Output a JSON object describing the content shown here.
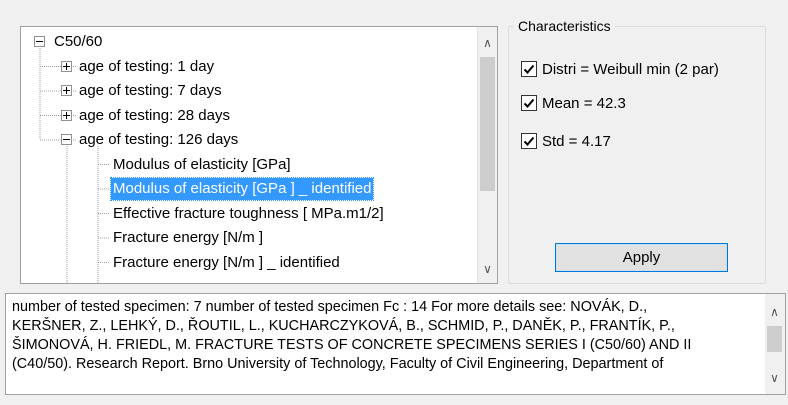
{
  "tree": {
    "root_label": "C50/60",
    "items": [
      {
        "label": "age of testing: 1 day",
        "expander": "plus"
      },
      {
        "label": "age of testing: 7 days",
        "expander": "plus"
      },
      {
        "label": "age of testing: 28 days",
        "expander": "plus"
      },
      {
        "label": "age of testing: 126 days",
        "expander": "minus"
      }
    ],
    "children": [
      {
        "label": "Modulus of elasticity  [GPa]",
        "selected": false
      },
      {
        "label": "Modulus of elasticity  [GPa ] _ identified",
        "selected": true
      },
      {
        "label": "Effective fracture toughness [ MPa.m1/2]",
        "selected": false
      },
      {
        "label": "Fracture energy [N/m ]",
        "selected": false
      },
      {
        "label": "Fracture energy [N/m ] _ identified",
        "selected": false
      }
    ],
    "selection_color": "#3399ff"
  },
  "characteristics": {
    "title": "Characteristics",
    "options": [
      {
        "label": "Distri = Weibull min (2 par)",
        "checked": true
      },
      {
        "label": "Mean = 42.3",
        "checked": true
      },
      {
        "label": "Std = 4.17",
        "checked": true
      }
    ],
    "apply_label": "Apply"
  },
  "details": {
    "lines": [
      "number of tested specimen: 7     number of tested specimen Fc : 14 For more details see: NOVÁK, D.,",
      "KERŠNER, Z., LEHKÝ, D., ŘOUTIL, L., KUCHARCZYKOVÁ, B., SCHMID, P., DANĚK, P., FRANTÍK, P.,",
      "ŠIMONOVÁ, H. FRIEDL, M. FRACTURE TESTS OF CONCRETE SPECIMENS SERIES I (C50/60) AND II",
      "(C40/50). Research Report. Brno University of Technology, Faculty of Civil Engineering, Department of"
    ]
  },
  "icons": {
    "scroll_up": "▲",
    "scroll_down": "▼",
    "tree_scroll_up": "∧",
    "tree_scroll_down": "∨"
  }
}
